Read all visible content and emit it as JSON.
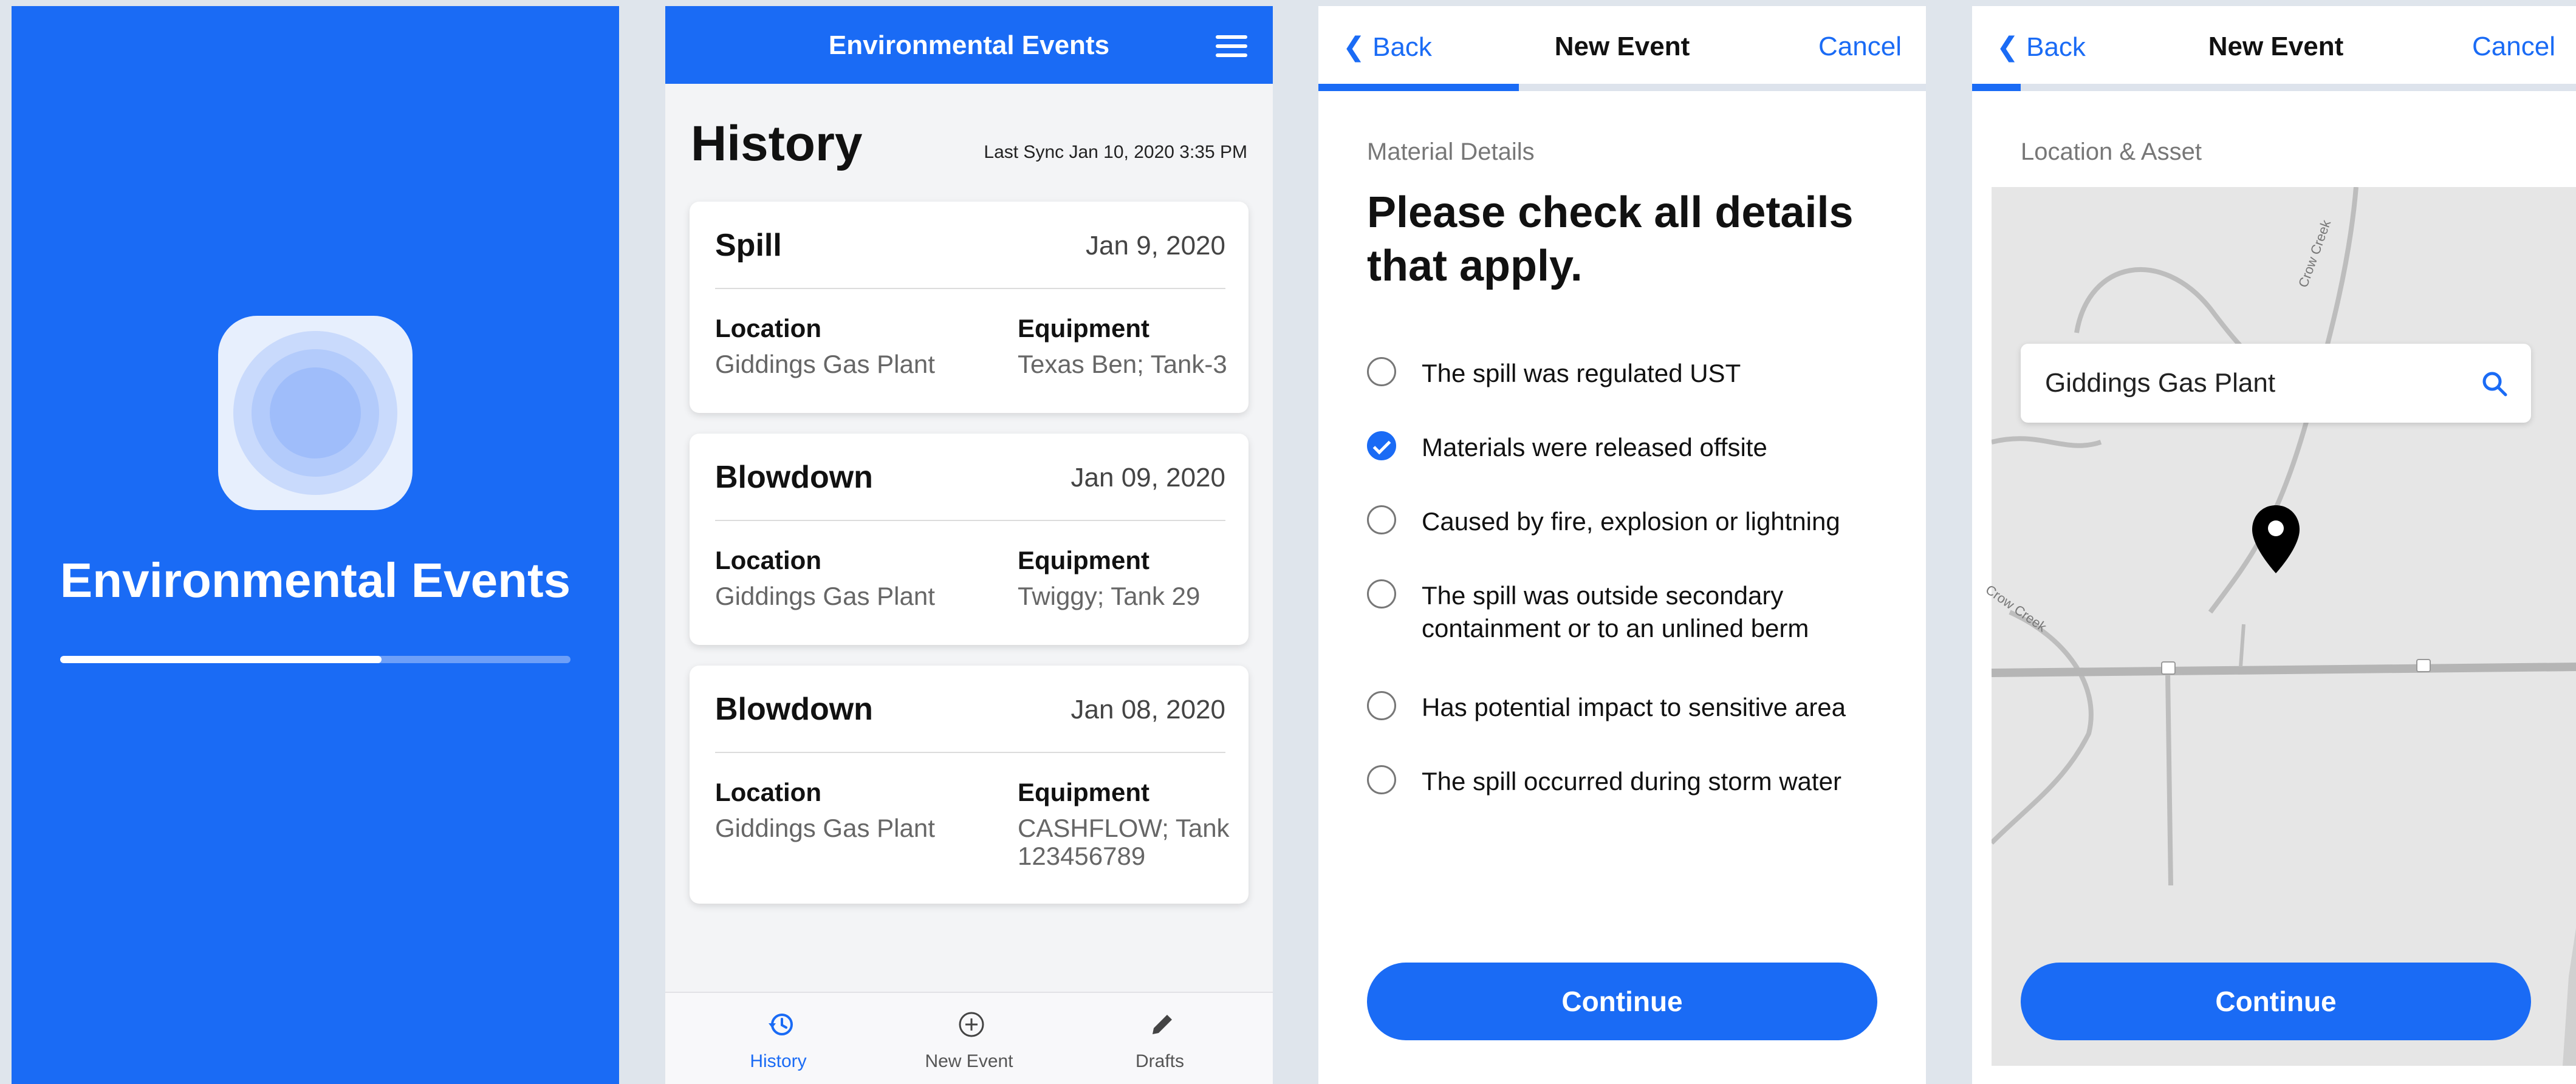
{
  "splash": {
    "app_name": "Environmental Events",
    "load_progress": 0.63,
    "icon": "concentric-circles-app-icon"
  },
  "history_screen": {
    "header_title": "Environmental Events",
    "menu_icon": "hamburger-menu-icon",
    "title": "History",
    "last_sync": "Last Sync Jan 10, 2020 3:35 PM",
    "cards": [
      {
        "type": "Spill",
        "date": "Jan 9, 2020",
        "location_label": "Location",
        "location": "Giddings Gas Plant",
        "equipment_label": "Equipment",
        "equipment": "Texas Ben; Tank-3"
      },
      {
        "type": "Blowdown",
        "date": "Jan 09, 2020",
        "location_label": "Location",
        "location": "Giddings Gas Plant",
        "equipment_label": "Equipment",
        "equipment": "Twiggy; Tank 29"
      },
      {
        "type": "Blowdown",
        "date": "Jan 08, 2020",
        "location_label": "Location",
        "location": "Giddings Gas Plant",
        "equipment_label": "Equipment",
        "equipment": "CASHFLOW; Tank 123456789"
      }
    ],
    "tabs": [
      {
        "label": "History",
        "icon": "history-icon",
        "active": true
      },
      {
        "label": "New Event",
        "icon": "add-circle-icon",
        "active": false
      },
      {
        "label": "Drafts",
        "icon": "pencil-icon",
        "active": false
      }
    ]
  },
  "details_screen": {
    "back_label": "Back",
    "title": "New Event",
    "cancel_label": "Cancel",
    "progress": 0.33,
    "section_label": "Material Details",
    "question": "Please check all details that apply.",
    "options": [
      {
        "label": "The spill was regulated UST",
        "checked": false
      },
      {
        "label": "Materials were released offsite",
        "checked": true
      },
      {
        "label": "Caused by fire, explosion or lightning",
        "checked": false
      },
      {
        "label": "The spill was outside secondary containment or to an unlined berm",
        "checked": false
      },
      {
        "label": "Has potential impact to sensitive area",
        "checked": false
      },
      {
        "label": "The spill occurred during storm water",
        "checked": false
      }
    ],
    "continue_label": "Continue"
  },
  "location_screen": {
    "back_label": "Back",
    "title": "New Event",
    "cancel_label": "Cancel",
    "progress": 0.08,
    "section_label": "Location & Asset",
    "search_value": "Giddings Gas Plant",
    "map_labels": [
      "Crow Creek",
      "Crow Creek"
    ],
    "continue_label": "Continue"
  },
  "colors": {
    "accent": "#1a6bf5",
    "background": "#dfe5ec",
    "card": "#ffffff",
    "muted_text": "#666666"
  }
}
